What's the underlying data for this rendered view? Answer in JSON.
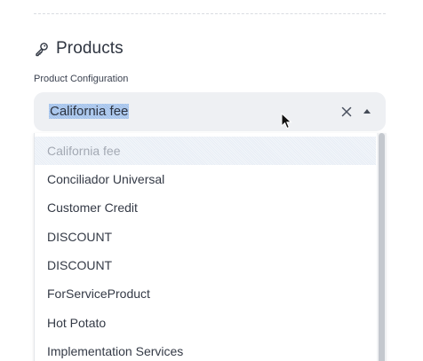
{
  "section": {
    "title": "Products",
    "icon": "key-icon"
  },
  "field": {
    "label": "Product Configuration",
    "selected_value": "California fee"
  },
  "dropdown": {
    "options": [
      "California fee",
      "Conciliador Universal",
      "Customer Credit",
      "DISCOUNT",
      "DISCOUNT",
      "ForServiceProduct",
      "Hot Potato",
      "Implementation Services"
    ],
    "selected_index": 0
  },
  "colors": {
    "text": "#2e3440",
    "select_bg": "#eef0f3",
    "highlight": "#b9d1f1",
    "muted": "#a3a9b3"
  }
}
